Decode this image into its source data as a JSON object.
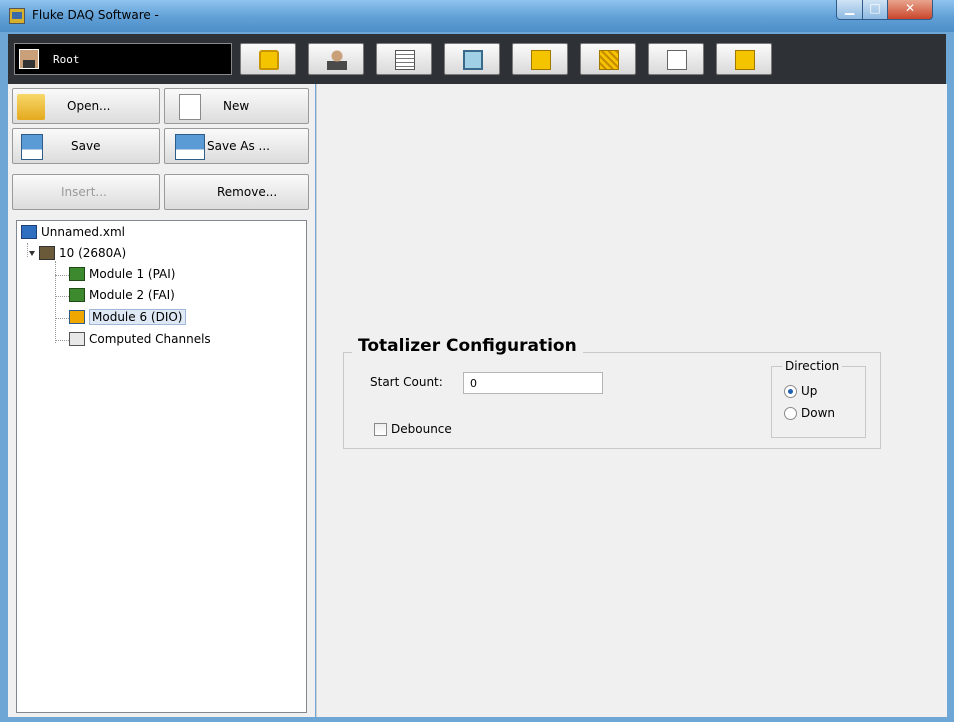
{
  "window": {
    "title": "Fluke DAQ Software -",
    "min_glyph": "▁",
    "max_glyph": "□",
    "close_glyph": "✕"
  },
  "toolbar": {
    "user_name": "Root",
    "buttons": [
      {
        "name": "lock-icon",
        "color": "#e8b300"
      },
      {
        "name": "user-admin-icon",
        "color": "#8a6a4a"
      },
      {
        "name": "list-icon",
        "color": "#555555"
      },
      {
        "name": "network-icon",
        "color": "#3a8a5a"
      },
      {
        "name": "chart-icon",
        "color": "#f0b400"
      },
      {
        "name": "meter-icon",
        "color": "#f0b400"
      },
      {
        "name": "email-icon",
        "color": "#666666"
      },
      {
        "name": "close-box-icon",
        "color": "#f0b400"
      }
    ]
  },
  "file_buttons": {
    "open": "Open...",
    "new": "New",
    "save": "Save",
    "save_as": "Save As ...",
    "insert": "Insert...",
    "remove": "Remove..."
  },
  "tree": {
    "root": "Unnamed.xml",
    "instrument": "10 (2680A)",
    "modules": [
      "Module 1 (PAI)",
      "Module 2 (FAI)",
      "Module 6 (DIO)"
    ],
    "computed": "Computed Channels",
    "selected": "Module 6 (DIO)"
  },
  "totalizer": {
    "title": "Totalizer Configuration",
    "start_count_label": "Start Count:",
    "start_count_value": "0",
    "debounce_label": "Debounce",
    "debounce_checked": false,
    "direction_title": "Direction",
    "direction_options": [
      "Up",
      "Down"
    ],
    "direction_selected": "Up"
  }
}
